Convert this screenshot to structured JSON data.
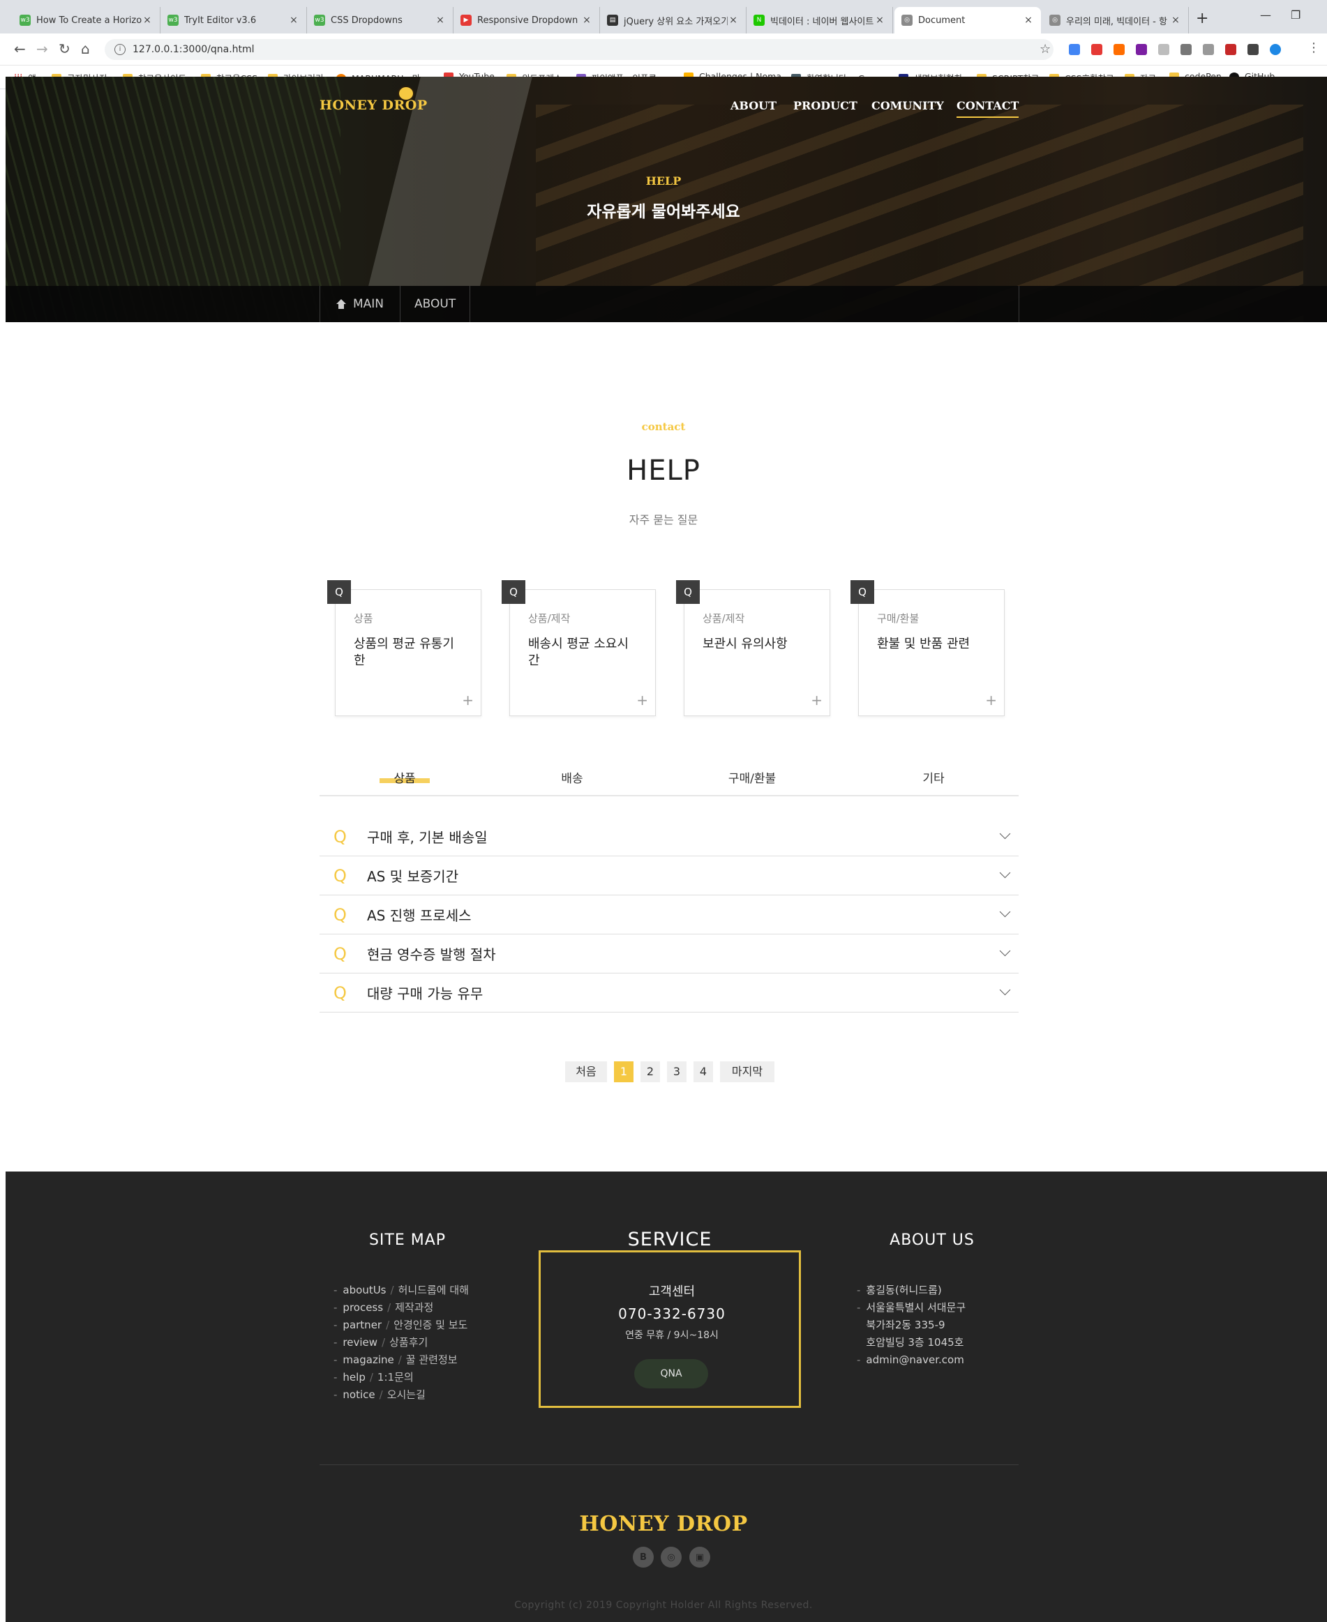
{
  "browser": {
    "tabs": [
      {
        "title": "How To Create a Horizontal",
        "favicon": "w3-icon",
        "color": "#4caf50",
        "active": false
      },
      {
        "title": "TryIt Editor v3.6",
        "favicon": "w3-icon",
        "color": "#4caf50",
        "active": false
      },
      {
        "title": "CSS Dropdowns",
        "favicon": "w3-icon",
        "color": "#4caf50",
        "active": false
      },
      {
        "title": "Responsive Dropdown Nav",
        "favicon": "youtube-icon",
        "color": "#e53935",
        "active": false
      },
      {
        "title": "jQuery 상위 요소 가져오기",
        "favicon": "page-icon",
        "color": "#333333",
        "active": false
      },
      {
        "title": "빅데이터 : 네이버 웹사이트",
        "favicon": "naver-icon",
        "color": "#1ec800",
        "active": false
      },
      {
        "title": "Document",
        "favicon": "globe-icon",
        "color": "#666666",
        "active": true
      },
      {
        "title": "우리의 미래, 빅데이터 - 항",
        "favicon": "globe-icon",
        "color": "#666666",
        "active": false
      }
    ],
    "url": "127.0.0.1:3000/qna.html",
    "bookmarks": [
      {
        "label": "앱"
      },
      {
        "label": "글자및사진"
      },
      {
        "label": "참고용사이트"
      },
      {
        "label": "참고용CSS"
      },
      {
        "label": "라이브러리"
      },
      {
        "label": "MARUMARU - 마..."
      },
      {
        "label": "YouTube"
      },
      {
        "label": "워드프레스"
      },
      {
        "label": "파인앳플 - 인플루..."
      },
      {
        "label": "Challenges | Noma..."
      },
      {
        "label": "환영합니다. - Goo..."
      },
      {
        "label": "생명보험협회"
      },
      {
        "label": "SCRIPT참고"
      },
      {
        "label": "CSS호환참고"
      },
      {
        "label": "자료"
      },
      {
        "label": "codePen"
      },
      {
        "label": "GitHub"
      }
    ]
  },
  "header": {
    "logo": "HONEY DROP",
    "nav": [
      {
        "label": "ABOUT",
        "active": false
      },
      {
        "label": "PRODUCT",
        "active": false
      },
      {
        "label": "COMUNITY",
        "active": false
      },
      {
        "label": "CONTACT",
        "active": true
      }
    ],
    "hero_kicker": "HELP",
    "hero_title": "자유롭게 물어봐주세요",
    "breadcrumb": [
      "MAIN",
      "ABOUT"
    ]
  },
  "section": {
    "kicker": "contact",
    "title": "HELP",
    "desc": "자주 묻는 질문"
  },
  "cards": [
    {
      "badge": "Q",
      "category": "상품",
      "question": "상품의 평균 유통기한"
    },
    {
      "badge": "Q",
      "category": "상품/제작",
      "question": "배송시 평균 소요시간"
    },
    {
      "badge": "Q",
      "category": "상품/제작",
      "question": "보관시 유의사항"
    },
    {
      "badge": "Q",
      "category": "구매/환불",
      "question": "환불 및 반품 관련"
    }
  ],
  "faq_tabs": [
    {
      "label": "상품",
      "active": true
    },
    {
      "label": "배송",
      "active": false
    },
    {
      "label": "구매/환불",
      "active": false
    },
    {
      "label": "기타",
      "active": false
    }
  ],
  "faq_items": [
    {
      "q": "Q",
      "text": "구매 후, 기본 배송일"
    },
    {
      "q": "Q",
      "text": "AS 및 보증기간"
    },
    {
      "q": "Q",
      "text": "AS 진행 프로세스"
    },
    {
      "q": "Q",
      "text": "현금 영수증 발행 절차"
    },
    {
      "q": "Q",
      "text": "대량 구매 가능 유무"
    }
  ],
  "pagination": {
    "first": "처음",
    "pages": [
      "1",
      "2",
      "3",
      "4"
    ],
    "current": "1",
    "last": "마지막"
  },
  "footer": {
    "sitemap_title": "SITE MAP",
    "sitemap": [
      {
        "en": "aboutUs",
        "ko": "허니드롭에 대해"
      },
      {
        "en": "process",
        "ko": "제작과정"
      },
      {
        "en": "partner",
        "ko": "안경인증 및 보도"
      },
      {
        "en": "review",
        "ko": "상품후기"
      },
      {
        "en": "magazine",
        "ko": "꿀 관련정보"
      },
      {
        "en": "help",
        "ko": "1:1문의"
      },
      {
        "en": "notice",
        "ko": "오시는길"
      }
    ],
    "service_title": "SERVICE",
    "service_label": "고객센터",
    "service_tel": "070-332-6730",
    "service_hours": "연중 무휴 / 9시~18시",
    "service_button": "QNA",
    "about_title": "ABOUT US",
    "about": [
      "홍길동(허니드롭)",
      "서울울특별시 서대문구",
      "북가좌2동 335-9",
      "호암빌딩 3층 1045호",
      "admin@naver.com"
    ],
    "about_dash": [
      true,
      true,
      false,
      false,
      true
    ],
    "logo": "HONEY DROP",
    "social": [
      "B",
      "◎",
      "▣"
    ],
    "copyright": "Copyright (c) 2019 Copyright Holder All Rights Reserved."
  },
  "colors": {
    "accent": "#f5c842",
    "footer_bg": "#252525",
    "service_border": "#e2be3f"
  }
}
